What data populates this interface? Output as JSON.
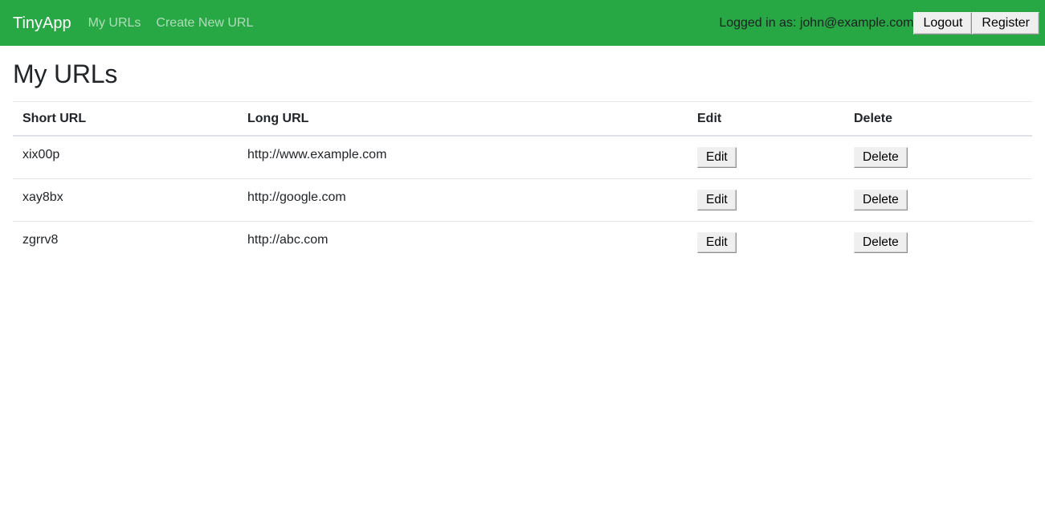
{
  "navbar": {
    "brand": "TinyApp",
    "links": [
      {
        "label": "My URLs"
      },
      {
        "label": "Create New URL"
      }
    ],
    "logged_in_text": "Logged in as: john@example.com",
    "logout_label": "Logout",
    "register_label": "Register",
    "background_color": "#28a745"
  },
  "page": {
    "title": "My URLs"
  },
  "table": {
    "headers": {
      "short": "Short URL",
      "long": "Long URL",
      "edit": "Edit",
      "delete": "Delete"
    },
    "rows": [
      {
        "short": "xix00p",
        "long": "http://www.example.com",
        "edit_label": "Edit",
        "delete_label": "Delete"
      },
      {
        "short": "xay8bx",
        "long": "http://google.com",
        "edit_label": "Edit",
        "delete_label": "Delete"
      },
      {
        "short": "zgrrv8",
        "long": "http://abc.com",
        "edit_label": "Edit",
        "delete_label": "Delete"
      }
    ]
  }
}
